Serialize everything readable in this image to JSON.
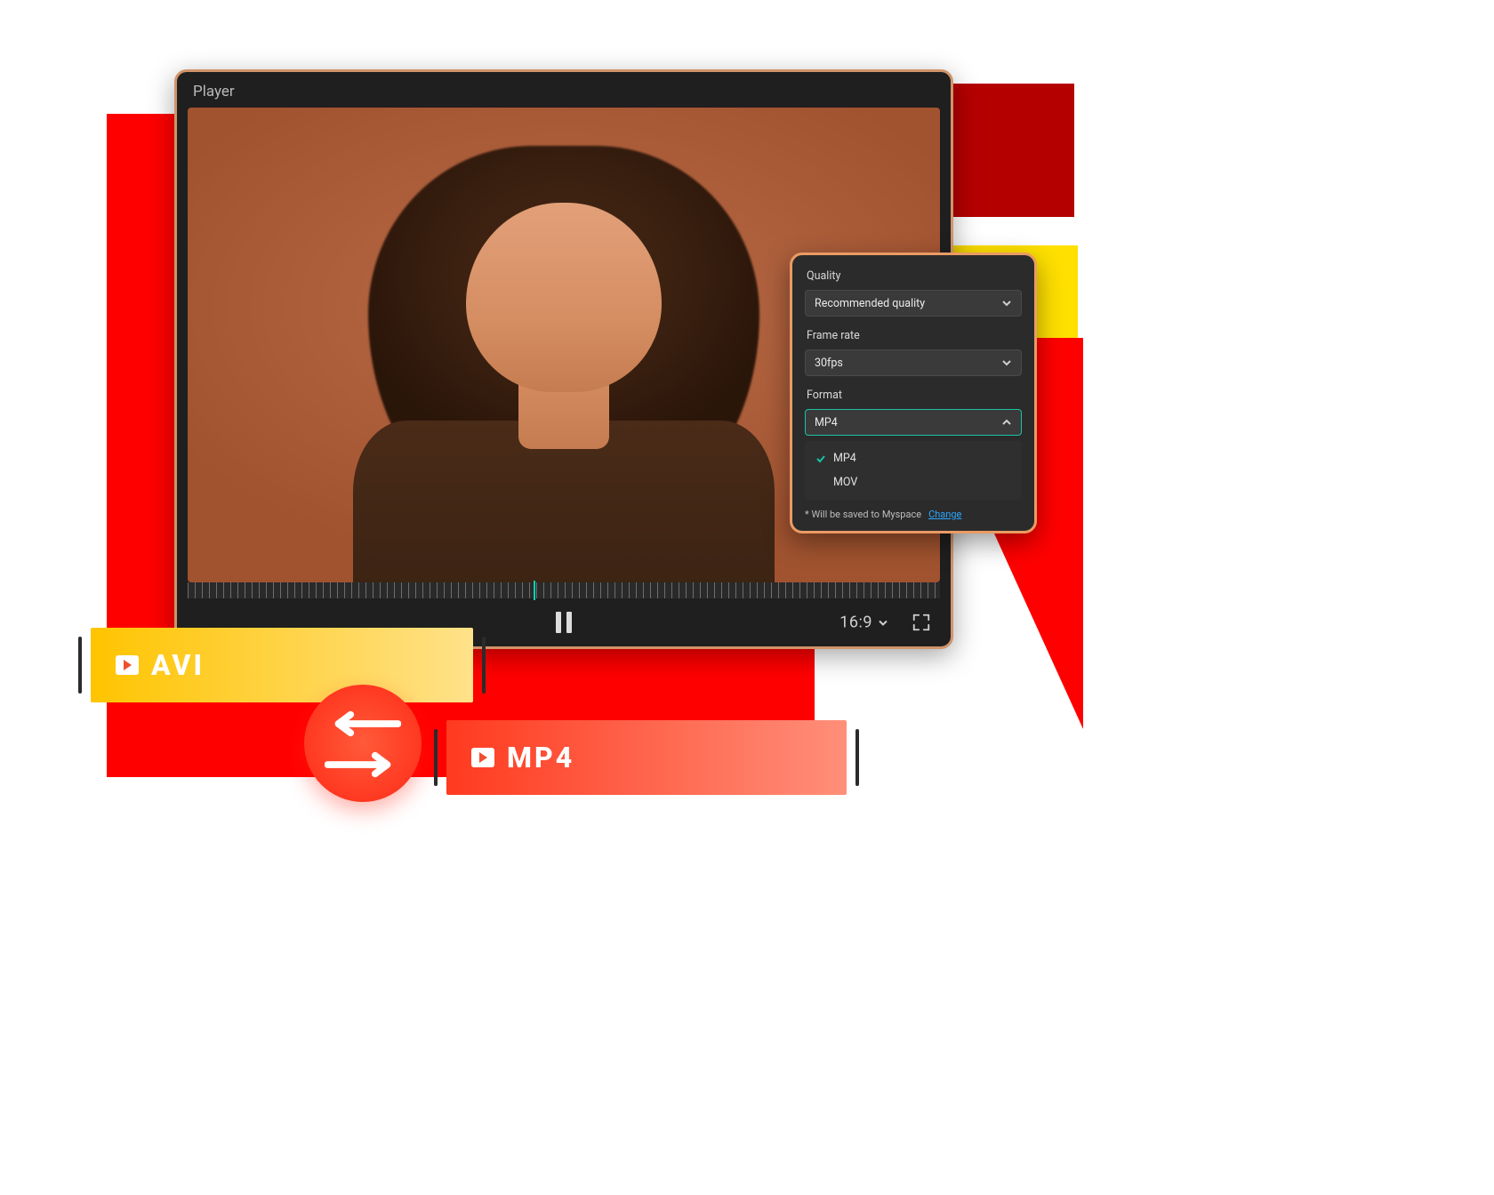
{
  "player": {
    "title": "Player",
    "aspect_label": "16:9"
  },
  "panel": {
    "quality_label": "Quality",
    "quality_value": "Recommended quality",
    "framerate_label": "Frame rate",
    "framerate_value": "30fps",
    "format_label": "Format",
    "format_value": "MP4",
    "format_options": {
      "0": "MP4",
      "1": "MOV"
    },
    "note_text": "* Will be saved to Myspace",
    "note_link": "Change"
  },
  "chips": {
    "avi": "AVI",
    "mp4": "MP4"
  }
}
